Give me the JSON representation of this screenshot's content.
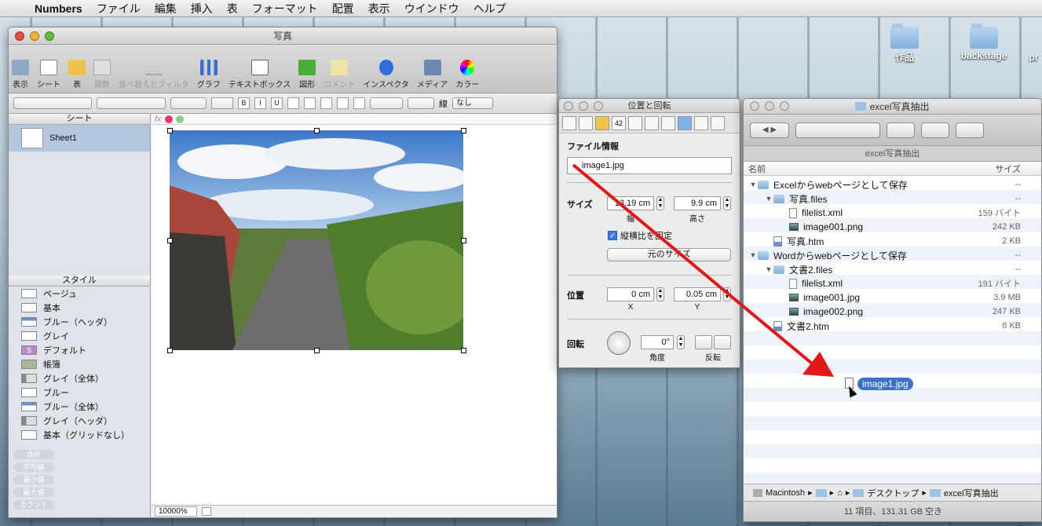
{
  "menubar": {
    "app": "Numbers",
    "items": [
      "ファイル",
      "編集",
      "挿入",
      "表",
      "フォーマット",
      "配置",
      "表示",
      "ウインドウ",
      "ヘルプ"
    ]
  },
  "desktop": {
    "icons": [
      {
        "label": "作品",
        "icon": "folder-icon"
      },
      {
        "label": "backstage",
        "icon": "folder-icon"
      },
      {
        "label": "pr",
        "icon": "file-icon"
      }
    ]
  },
  "numbers": {
    "title": "写真",
    "toolbar": [
      {
        "label": "表示",
        "icon": "view-icon",
        "enabled": true
      },
      {
        "label": "シート",
        "icon": "sheet-icon",
        "enabled": true
      },
      {
        "label": "表",
        "icon": "table-icon",
        "enabled": true
      },
      {
        "label": "関数",
        "icon": "sigma-icon",
        "enabled": false
      },
      {
        "label": "並べ替えとフィルタ",
        "icon": "filter-icon",
        "enabled": false
      },
      {
        "label": "グラフ",
        "icon": "chart-icon",
        "enabled": true
      },
      {
        "label": "テキストボックス",
        "icon": "textbox-icon",
        "enabled": true
      },
      {
        "label": "図形",
        "icon": "shape-icon",
        "enabled": true
      },
      {
        "label": "コメント",
        "icon": "comment-icon",
        "enabled": false
      },
      {
        "label": "インスペクタ",
        "icon": "info-icon",
        "enabled": true
      },
      {
        "label": "メディア",
        "icon": "media-icon",
        "enabled": true
      },
      {
        "label": "カラー",
        "icon": "color-wheel-icon",
        "enabled": true
      }
    ],
    "format_bar": {
      "line_label": "線",
      "line_value": "なし",
      "bold": "B",
      "italic": "I",
      "underline": "U"
    },
    "sidebar": {
      "sheets_header": "シート",
      "sheet_name": "Sheet1",
      "styles_header": "スタイル",
      "styles": [
        "ページュ",
        "基本",
        "ブルー（ヘッダ）",
        "グレイ",
        "デフォルト",
        "帳簿",
        "グレイ（全体）",
        "ブルー",
        "ブルー（全体）",
        "グレイ（ヘッダ）",
        "基本（グリッドなし）"
      ],
      "style_swatch_letter": "S",
      "functions": [
        "合計",
        "平均値",
        "最小値",
        "最大値",
        "カウント"
      ]
    },
    "formula_bar": {
      "fx": "fx"
    },
    "zoom": "10000%",
    "photo": {
      "description_icon": "road-landscape-photo"
    }
  },
  "inspector": {
    "title": "位置と回転",
    "section_file": "ファイル情報",
    "file_name": "image1.jpg",
    "size_label": "サイズ",
    "width_value": "13.19 cm",
    "width_caption": "幅",
    "height_value": "9.9 cm",
    "height_caption": "高さ",
    "constrain_label": "縦横比を固定",
    "constrain_checked": true,
    "original_size_button": "元のサイズ",
    "position_label": "位置",
    "x_value": "0 cm",
    "x_caption": "X",
    "y_value": "0.05 cm",
    "y_caption": "Y",
    "rotate_label": "回転",
    "angle_value": "0°",
    "angle_caption": "角度",
    "flip_caption": "反転",
    "tab_chart_label": "42"
  },
  "finder": {
    "title": "excel写真抽出",
    "tab_title": "excel写真抽出",
    "col_name": "名前",
    "col_size": "サイズ",
    "rows": [
      {
        "indent": 0,
        "disclosure": "▼",
        "kind": "dir",
        "name": "Excelからwebページとして保存",
        "size": "--"
      },
      {
        "indent": 1,
        "disclosure": "▼",
        "kind": "dir",
        "name": "写真.files",
        "size": "--"
      },
      {
        "indent": 2,
        "disclosure": "",
        "kind": "file",
        "name": "filelist.xml",
        "size": "159 バイト"
      },
      {
        "indent": 2,
        "disclosure": "",
        "kind": "img",
        "name": "image001.png",
        "size": "242 KB"
      },
      {
        "indent": 1,
        "disclosure": "",
        "kind": "htm",
        "name": "写真.htm",
        "size": "2 KB"
      },
      {
        "indent": 0,
        "disclosure": "▼",
        "kind": "dir",
        "name": "Wordからwebページとして保存",
        "size": "--"
      },
      {
        "indent": 1,
        "disclosure": "▼",
        "kind": "dir",
        "name": "文書2.files",
        "size": "--"
      },
      {
        "indent": 2,
        "disclosure": "",
        "kind": "file",
        "name": "filelist.xml",
        "size": "191 バイト"
      },
      {
        "indent": 2,
        "disclosure": "",
        "kind": "img",
        "name": "image001.jpg",
        "size": "3.9 MB"
      },
      {
        "indent": 2,
        "disclosure": "",
        "kind": "img",
        "name": "image002.png",
        "size": "247 KB"
      },
      {
        "indent": 1,
        "disclosure": "",
        "kind": "htm",
        "name": "文書2.htm",
        "size": "6 KB"
      }
    ],
    "dragged_item": "image1.jpg",
    "path": [
      "Macintosh",
      "",
      "",
      "デスクトップ",
      "excel写真抽出"
    ],
    "status": "11 項目、131.31 GB 空き"
  },
  "colors": {
    "accent": "#3b72c8",
    "arrow": "#e01818",
    "selection": "#b5c7de"
  }
}
